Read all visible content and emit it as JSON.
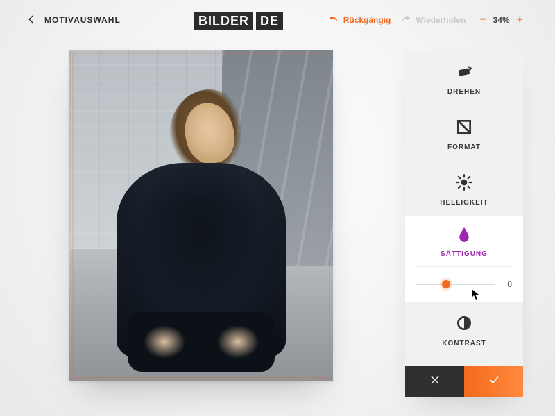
{
  "colors": {
    "accent": "#f36a1f",
    "active": "#9c27b0",
    "muted": "#c9c9c9"
  },
  "header": {
    "back_label": "MOTIVAUSWAHL",
    "logo_left": "BILDER",
    "logo_right": "DE"
  },
  "history": {
    "undo_label": "Rückgängig",
    "redo_label": "Wiederholen",
    "undo_enabled": true,
    "redo_enabled": false
  },
  "zoom": {
    "percent_label": "34%"
  },
  "tools": {
    "rotate": {
      "label": "DREHEN"
    },
    "format": {
      "label": "FORMAT"
    },
    "brightness": {
      "label": "HELLIGKEIT"
    },
    "saturation": {
      "label": "SÄTTIGUNG",
      "value_label": "0",
      "slider_percent": 38
    },
    "contrast": {
      "label": "KONTRAST"
    }
  },
  "icons": {
    "back": "chevron-left",
    "undo": "undo-arrow",
    "redo": "redo-arrow",
    "rotate": "rotate",
    "format": "crop-frame",
    "brightness": "sun",
    "saturation": "droplet",
    "contrast": "half-circle",
    "cancel": "x",
    "confirm": "check"
  }
}
